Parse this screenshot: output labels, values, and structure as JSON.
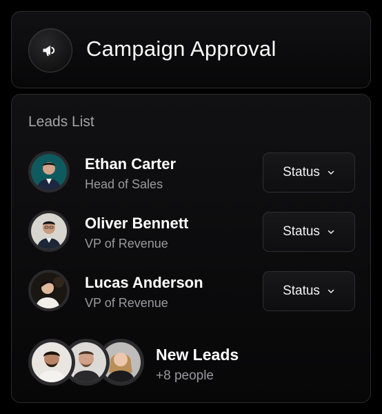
{
  "header": {
    "title": "Campaign Approval",
    "icon": "megaphone-icon"
  },
  "leads_list": {
    "title": "Leads List",
    "items": [
      {
        "name": "Ethan Carter",
        "role": "Head of Sales",
        "status_label": "Status"
      },
      {
        "name": "Oliver Bennett",
        "role": "VP of Revenue",
        "status_label": "Status"
      },
      {
        "name": "Lucas Anderson",
        "role": "VP of Revenue",
        "status_label": "Status"
      }
    ],
    "new_leads": {
      "title": "New Leads",
      "count_text": "+8 people"
    }
  },
  "colors": {
    "background": "#000000",
    "card_border": "#2c2c2e",
    "muted_text": "#9a9aa0",
    "accent_teal": "#0f5a5e"
  }
}
